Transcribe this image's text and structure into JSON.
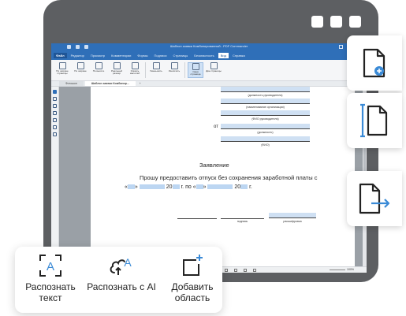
{
  "app": {
    "title": "Шаблон заявки Комбинированный - PDF Commander",
    "menu": [
      "Файл",
      "Редактор",
      "Просмотр",
      "Комментарии",
      "Формы",
      "Подписи",
      "Страницы",
      "Безопасность",
      "Вид",
      "Справка"
    ],
    "ribbon": [
      {
        "label": "По ширине страницы",
        "icon": "fit-width-icon"
      },
      {
        "label": "По ширине",
        "icon": "fit-page-icon"
      },
      {
        "label": "По высоте",
        "icon": "fit-height-icon"
      },
      {
        "label": "Реальный размер",
        "icon": "actual-size-icon"
      },
      {
        "label": "Указать масштаб",
        "icon": "zoom-set-icon"
      },
      {
        "label": "Уменьшить",
        "icon": "zoom-out-icon"
      },
      {
        "label": "Увеличить",
        "icon": "zoom-in-icon"
      },
      {
        "label": "Одна страница",
        "icon": "single-page-icon"
      },
      {
        "label": "Две страницы",
        "icon": "two-pages-icon"
      }
    ],
    "tabs": [
      "Фотошоп",
      "Шаблон заявки Комбинир..."
    ],
    "tab_add": "+",
    "zoom": "100%"
  },
  "document": {
    "fields": [
      {
        "caption": "(должность руководителя)"
      },
      {
        "caption": "(наименование организации)"
      },
      {
        "caption": "(ФИО руководителя)"
      },
      {
        "caption": "(должность)"
      },
      {
        "caption": "(ФИО)"
      }
    ],
    "from_label": "от",
    "heading": "Заявление",
    "body_line": "Прошу предоставить отпуск без сохранения заработной платы с",
    "date_year": "20",
    "date_suffix": "г.",
    "date_to": "по",
    "sign_caption": "подпись",
    "decode_caption": "расшифровка"
  },
  "actions": [
    {
      "label": "Распознать текст",
      "icon": "recognize-text-icon"
    },
    {
      "label": "Распознать с AI",
      "icon": "recognize-ai-icon"
    },
    {
      "label": "Добавить область",
      "icon": "add-area-icon"
    }
  ],
  "side_tools": [
    {
      "icon": "add-page-icon"
    },
    {
      "icon": "crop-page-icon"
    },
    {
      "icon": "extract-page-icon"
    }
  ],
  "colors": {
    "accent": "#2f6fb8",
    "frame": "#5d5f62",
    "field_highlight": "#cfe0f3"
  }
}
